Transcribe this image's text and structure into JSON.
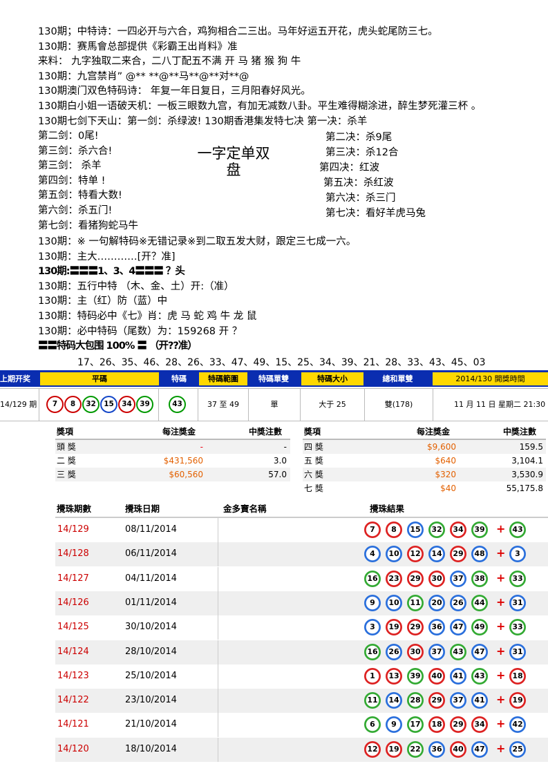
{
  "lines_top": [
    "130期；中特诗：一四必开与六合，鸡狗相合二三出。马年好运五开花，虎头蛇尾防三七。",
    "130期：赛馬會总部提供《彩霸王出肖料》准",
    "来料：  九字独取二来合，二八丁配五不满      开 马 猪 猴 狗 牛",
    "130期：九宫禁肖”   @** **@**马**@**对**@",
    "130期澳门双色特码诗：  年复一年日复日，三月阳春好风光。",
    "130期白小姐一语破天机：一板三眼数九宫，有加无减数八卦。平生难得糊涂进，醉生梦死灌三杯  。",
    "130期七剑下天山：第一剑：杀绿波!          130期香港集发特七决  第一决：杀羊"
  ],
  "swords": [
    "第二剑：0尾!",
    "第三剑：杀六合!",
    "第三剑：  杀羊",
    "第四剑：特单 !",
    "第五剑：特看大数!",
    "第六剑：杀五门!",
    "第七剑：看猪狗蛇马牛"
  ],
  "jue": [
    "第二决：杀9尾",
    "第三决：杀12合",
    "第四决：红波",
    "第五决：杀红波",
    "第六决：杀三门",
    "第七决：看好羊虎马兔"
  ],
  "big_title": "一字定单双 盘",
  "lines_bottom": [
    "130期：※ 一句解特码※无错记录※到二取五发大财，跟定三七成一六。",
    "130期：主大…………[开？准]",
    "130期:〓〓〓1、3、4〓〓〓 ？头",
    "130期：五行中特   （木、金、土）开:（准）",
    "130期：主（红）防（蓝）中",
    "130期：特码必中《七》肖：虎 马 蛇 鸡 牛 龙 鼠",
    "130期：必中特码（尾数）为：159268   开 ？",
    "〓〓特码大包围 100% 〓  （开??准）"
  ],
  "number_list": "17、26、35、46、28、26、33、47、49、15、25、34、39、21、28、33、43、45、03",
  "header": {
    "period_label": "上期开奖",
    "ping_ma": "平碼",
    "te_ma": "特碼",
    "range": "特碼範圍",
    "odd_even": "特碼單雙",
    "size": "特碼大小",
    "sum": "總和單雙",
    "next": "2014/130 開獎時間"
  },
  "latest": {
    "period": "14/129 期",
    "balls": [
      {
        "n": "7",
        "c": "red"
      },
      {
        "n": "8",
        "c": "red"
      },
      {
        "n": "32",
        "c": "green"
      },
      {
        "n": "15",
        "c": "blue"
      },
      {
        "n": "34",
        "c": "red"
      },
      {
        "n": "39",
        "c": "green"
      }
    ],
    "special": "43",
    "range": "37 至 49",
    "odd_even": "單",
    "size": "大于 25",
    "sum": "雙(178)",
    "time": "11 月 11 日 星期二 21:30"
  },
  "prizes_left": {
    "head": [
      "獎項",
      "每注獎金",
      "中獎注數"
    ],
    "rows": [
      [
        "頭 獎",
        "-",
        "-"
      ],
      [
        "二 獎",
        "$431,560",
        "3.0"
      ],
      [
        "三 獎",
        "$60,560",
        "57.0"
      ]
    ]
  },
  "prizes_right": {
    "head": [
      "獎項",
      "每注獎金",
      "中獎注數"
    ],
    "rows": [
      [
        "四 獎",
        "$9,600",
        "159.5"
      ],
      [
        "五 獎",
        "$640",
        "3,104.1"
      ],
      [
        "六 獎",
        "$320",
        "3,530.9"
      ],
      [
        "七 獎",
        "$40",
        "55,175.8"
      ]
    ]
  },
  "history_head": [
    "攪珠期數",
    "攪珠日期",
    "金多寶名稱",
    "攪珠結果"
  ],
  "history": [
    {
      "p": "14/129",
      "d": "08/11/2014",
      "b": [
        "7",
        "8",
        "15",
        "32",
        "34",
        "39"
      ],
      "s": "43",
      "c": [
        "#d22",
        "#d22",
        "#2a6fdc",
        "#3a3",
        "#d22",
        "#3a3",
        "#3a3"
      ]
    },
    {
      "p": "14/128",
      "d": "06/11/2014",
      "b": [
        "4",
        "10",
        "12",
        "14",
        "29",
        "48"
      ],
      "s": "3",
      "c": [
        "#2a6fdc",
        "#2a6fdc",
        "#d22",
        "#2a6fdc",
        "#d22",
        "#2a6fdc",
        "#2a6fdc"
      ]
    },
    {
      "p": "14/127",
      "d": "04/11/2014",
      "b": [
        "16",
        "23",
        "29",
        "30",
        "37",
        "38"
      ],
      "s": "33",
      "c": [
        "#3a3",
        "#d22",
        "#d22",
        "#d22",
        "#2a6fdc",
        "#3a3",
        "#3a3"
      ]
    },
    {
      "p": "14/126",
      "d": "01/11/2014",
      "b": [
        "9",
        "10",
        "11",
        "20",
        "26",
        "44"
      ],
      "s": "31",
      "c": [
        "#2a6fdc",
        "#2a6fdc",
        "#3a3",
        "#2a6fdc",
        "#2a6fdc",
        "#3a3",
        "#2a6fdc"
      ]
    },
    {
      "p": "14/125",
      "d": "30/10/2014",
      "b": [
        "3",
        "19",
        "29",
        "36",
        "47",
        "49"
      ],
      "s": "33",
      "c": [
        "#2a6fdc",
        "#d22",
        "#d22",
        "#2a6fdc",
        "#2a6fdc",
        "#3a3",
        "#3a3"
      ]
    },
    {
      "p": "14/124",
      "d": "28/10/2014",
      "b": [
        "16",
        "26",
        "30",
        "37",
        "43",
        "47"
      ],
      "s": "31",
      "c": [
        "#3a3",
        "#2a6fdc",
        "#d22",
        "#2a6fdc",
        "#3a3",
        "#2a6fdc",
        "#2a6fdc"
      ]
    },
    {
      "p": "14/123",
      "d": "25/10/2014",
      "b": [
        "1",
        "13",
        "39",
        "40",
        "41",
        "43"
      ],
      "s": "18",
      "c": [
        "#d22",
        "#d22",
        "#3a3",
        "#d22",
        "#2a6fdc",
        "#3a3",
        "#d22"
      ]
    },
    {
      "p": "14/122",
      "d": "23/10/2014",
      "b": [
        "11",
        "14",
        "28",
        "29",
        "37",
        "41"
      ],
      "s": "19",
      "c": [
        "#3a3",
        "#2a6fdc",
        "#3a3",
        "#d22",
        "#2a6fdc",
        "#2a6fdc",
        "#d22"
      ]
    },
    {
      "p": "14/121",
      "d": "21/10/2014",
      "b": [
        "6",
        "9",
        "17",
        "18",
        "29",
        "34"
      ],
      "s": "42",
      "c": [
        "#3a3",
        "#2a6fdc",
        "#3a3",
        "#d22",
        "#d22",
        "#d22",
        "#2a6fdc"
      ]
    },
    {
      "p": "14/120",
      "d": "18/10/2014",
      "b": [
        "12",
        "19",
        "22",
        "36",
        "40",
        "47"
      ],
      "s": "25",
      "c": [
        "#d22",
        "#d22",
        "#3a3",
        "#2a6fdc",
        "#d22",
        "#2a6fdc",
        "#2a6fdc"
      ]
    }
  ]
}
